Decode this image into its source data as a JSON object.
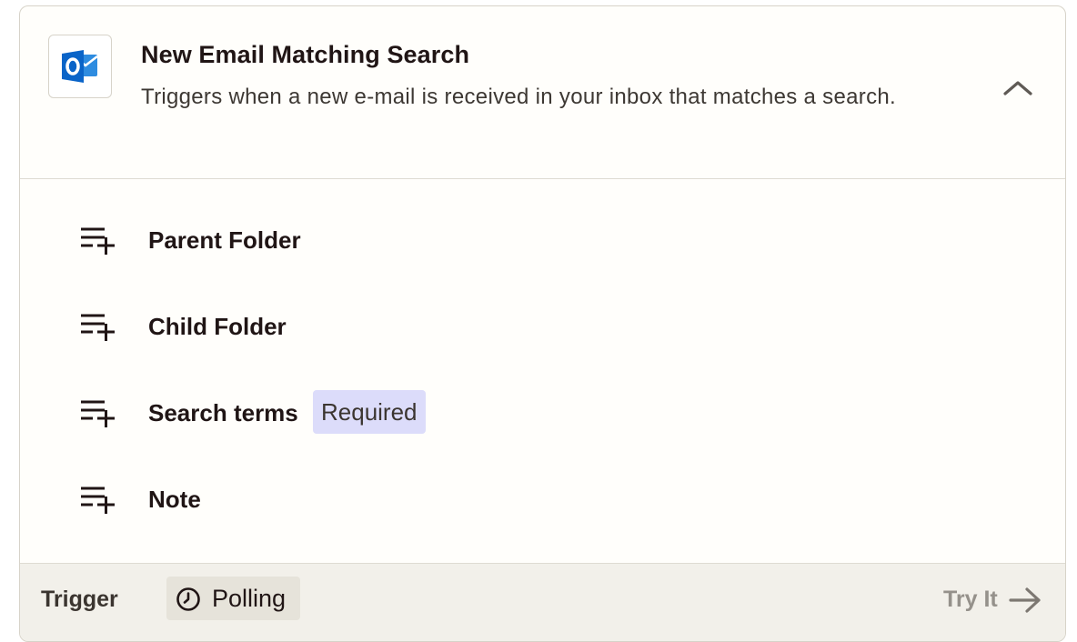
{
  "trigger_card": {
    "app_icon": "outlook-logo-icon",
    "title": "New Email Matching Search",
    "description": "Triggers when a new e-mail is received in your inbox that matches a search.",
    "collapse_icon": "chevron-up-icon"
  },
  "fields": [
    {
      "icon": "add-field-icon",
      "label": "Parent Folder"
    },
    {
      "icon": "add-field-icon",
      "label": "Child Folder"
    },
    {
      "icon": "add-field-icon",
      "label": "Search terms",
      "badge": "Required"
    },
    {
      "icon": "add-field-icon",
      "label": "Note"
    }
  ],
  "footer": {
    "type_label": "Trigger",
    "polling_icon": "clock-icon",
    "polling_label": "Polling",
    "try_it_label": "Try It",
    "try_it_icon": "arrow-right-icon"
  },
  "colors": {
    "outlook_blue": "#0a64c8",
    "required_badge": "#dcdcfa",
    "card_background": "#fffefb",
    "footer_background": "#f2f0ea"
  }
}
